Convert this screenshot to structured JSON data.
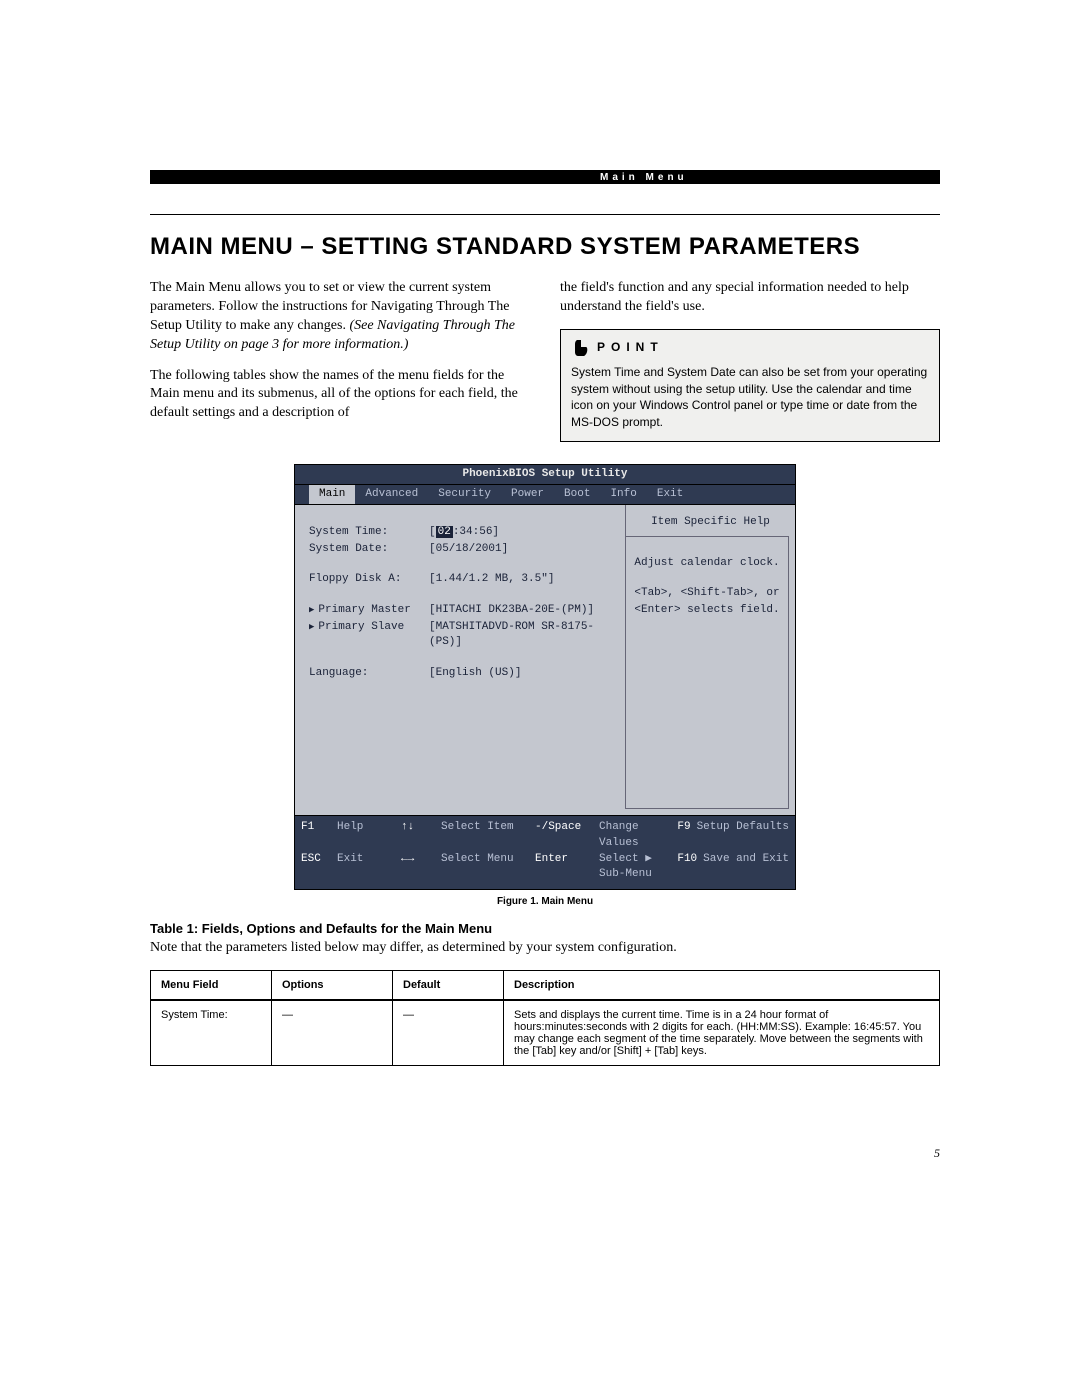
{
  "header_label": "Main Menu",
  "title": "MAIN MENU – SETTING STANDARD SYSTEM PARAMETERS",
  "left_col": {
    "p1": "The Main Menu allows you to set or view the current system parameters. Follow the instructions for Navigating Through The Setup Utility to make any changes.",
    "p1_italic": "(See Navigating Through The Setup Utility on page 3 for more information.)",
    "p2": "The following tables show the names of the menu fields for the Main menu and its submenus, all of the options for each field, the default settings and a description of"
  },
  "right_col": {
    "p1": "the field's function and any special information needed to help understand the field's use."
  },
  "point": {
    "label": "POINT",
    "text": "System Time and System Date can also be set from your operating system without using the setup utility. Use the calendar and time icon on your Windows Control panel or type time or date from the MS-DOS prompt."
  },
  "bios": {
    "title": "PhoenixBIOS Setup Utility",
    "tabs": [
      "Main",
      "Advanced",
      "Security",
      "Power",
      "Boot",
      "Info",
      "Exit"
    ],
    "rows": [
      {
        "label": "System Time:",
        "value_pre": "[",
        "value_hl": "02",
        "value_post": ":34:56]"
      },
      {
        "label": "System Date:",
        "value": "[05/18/2001]"
      },
      {
        "blank": true
      },
      {
        "label": "Floppy Disk A:",
        "value": "[1.44/1.2 MB, 3.5\"]"
      },
      {
        "blank": true
      },
      {
        "label": "Primary Master",
        "prefix": "▶",
        "value": "[HITACHI DK23BA-20E-(PM)]"
      },
      {
        "label": "Primary Slave",
        "prefix": "▶",
        "value": "[MATSHITADVD-ROM SR-8175-(PS)]"
      },
      {
        "blank": true
      },
      {
        "label": "Language:",
        "value": "[English (US)]"
      }
    ],
    "help_head": "Item Specific Help",
    "help_body1": "Adjust calendar clock.",
    "help_body2": "<Tab>, <Shift-Tab>, or <Enter> selects field.",
    "footer": {
      "f1": "F1",
      "f1d": "Help",
      "ar1": "↑↓",
      "ar1d": "Select Item",
      "sp": "-/Space",
      "spd": "Change Values",
      "f9": "F9",
      "f9d": "Setup Defaults",
      "esc": "ESC",
      "escd": "Exit",
      "ar2": "←→",
      "ar2d": "Select Menu",
      "ent": "Enter",
      "entd": "Select ▶ Sub-Menu",
      "f10": "F10",
      "f10d": "Save and Exit"
    }
  },
  "figure_caption": "Figure 1.  Main Menu",
  "table": {
    "title": "Table 1: Fields, Options and Defaults for the Main Menu",
    "note": "Note that the parameters listed below may differ, as determined by your system configuration.",
    "headers": [
      "Menu Field",
      "Options",
      "Default",
      "Description"
    ],
    "row": {
      "field": "System Time:",
      "options": "—",
      "defaultv": "—",
      "desc": "Sets and displays the current time. Time is in a 24 hour format of hours:minutes:seconds with 2 digits for each. (HH:MM:SS). Example: 16:45:57. You may change each segment of the time separately. Move between the segments with the [Tab] key and/or [Shift] + [Tab] keys."
    }
  },
  "page_number": "5"
}
